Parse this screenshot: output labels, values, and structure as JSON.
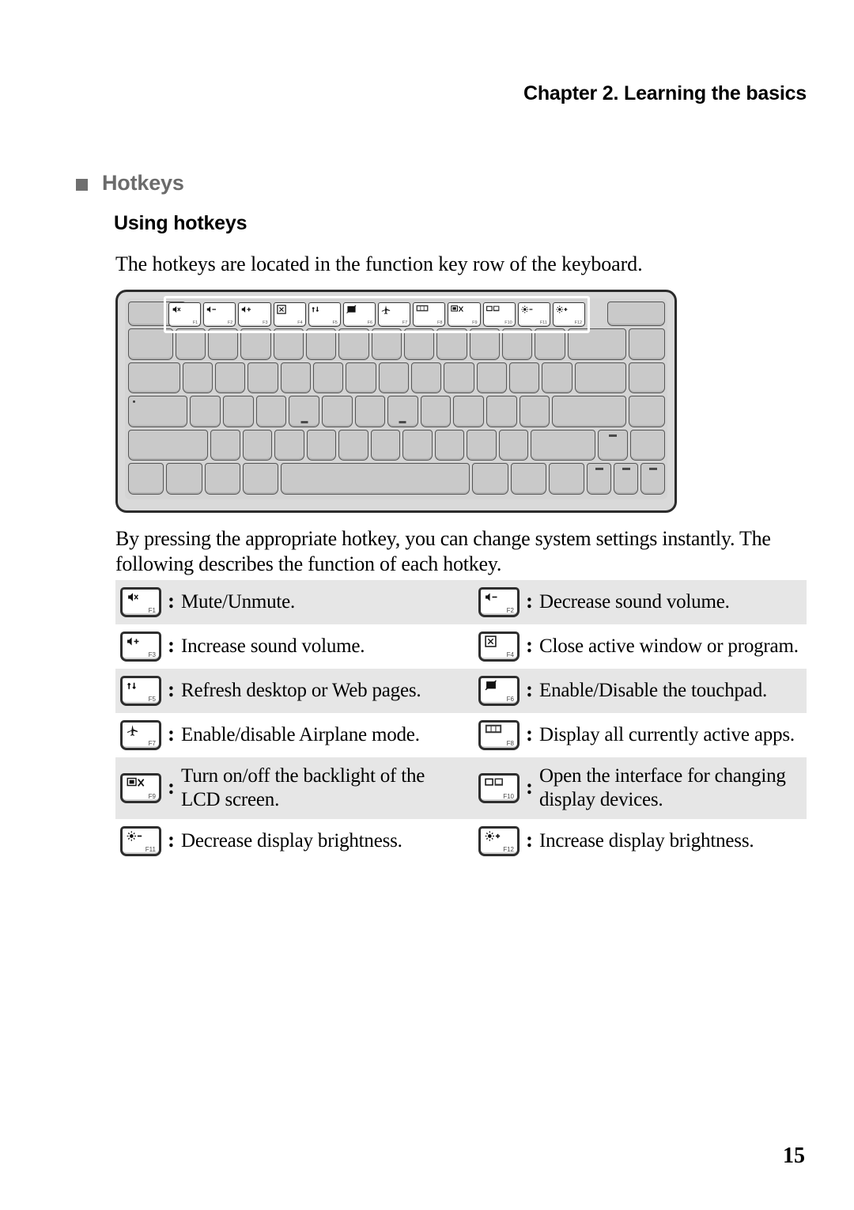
{
  "header": {
    "running_header": "Chapter 2. Learning the basics"
  },
  "section": {
    "bullet": "filled-square",
    "title": "Hotkeys",
    "subtitle": "Using hotkeys",
    "intro_paragraph": "The hotkeys are located in the function key row of the keyboard.",
    "body_paragraph": "By pressing the appropriate hotkey, you can change system settings instantly. The following describes the function of each hotkey."
  },
  "keyboard_figure": {
    "caption": "",
    "function_row_keys": [
      {
        "fkey": "F1",
        "icon": "mute-icon",
        "glyph": "×"
      },
      {
        "fkey": "F2",
        "icon": "volume-down-icon",
        "glyph": "−"
      },
      {
        "fkey": "F3",
        "icon": "volume-up-icon",
        "glyph": "+"
      },
      {
        "fkey": "F4",
        "icon": "close-window-icon",
        "glyph": "✕"
      },
      {
        "fkey": "F5",
        "icon": "refresh-icon",
        "glyph": "↺"
      },
      {
        "fkey": "F6",
        "icon": "touchpad-toggle-icon",
        "glyph": "╱"
      },
      {
        "fkey": "F7",
        "icon": "airplane-mode-icon",
        "glyph": "✈"
      },
      {
        "fkey": "F8",
        "icon": "task-view-icon",
        "glyph": "▭"
      },
      {
        "fkey": "F9",
        "icon": "lcd-backlight-icon",
        "glyph": "X"
      },
      {
        "fkey": "F10",
        "icon": "display-switch-icon",
        "glyph": "▭"
      },
      {
        "fkey": "F11",
        "icon": "brightness-down-icon",
        "glyph": "−"
      },
      {
        "fkey": "F12",
        "icon": "brightness-up-icon",
        "glyph": "+"
      }
    ]
  },
  "hotkey_table": {
    "rows": [
      {
        "shaded": true,
        "left": {
          "fkey": "F1",
          "icon": "mute-icon",
          "separator": ":",
          "description": "Mute/Unmute."
        },
        "right": {
          "fkey": "F2",
          "icon": "volume-down-icon",
          "separator": ":",
          "description": "Decrease sound volume."
        }
      },
      {
        "shaded": false,
        "left": {
          "fkey": "F3",
          "icon": "volume-up-icon",
          "separator": ":",
          "description": "Increase sound volume."
        },
        "right": {
          "fkey": "F4",
          "icon": "close-window-icon",
          "separator": ":",
          "description": "Close active window or program."
        }
      },
      {
        "shaded": true,
        "left": {
          "fkey": "F5",
          "icon": "refresh-icon",
          "separator": ":",
          "description": "Refresh desktop or Web pages."
        },
        "right": {
          "fkey": "F6",
          "icon": "touchpad-toggle-icon",
          "separator": ":",
          "description": "Enable/Disable the touchpad."
        }
      },
      {
        "shaded": false,
        "left": {
          "fkey": "F7",
          "icon": "airplane-mode-icon",
          "separator": ":",
          "description": "Enable/disable Airplane mode."
        },
        "right": {
          "fkey": "F8",
          "icon": "task-view-icon",
          "separator": ":",
          "description": "Display all currently active apps."
        }
      },
      {
        "shaded": true,
        "left": {
          "fkey": "F9",
          "icon": "lcd-backlight-icon",
          "separator": ":",
          "description": "Turn on/off the backlight of the LCD screen."
        },
        "right": {
          "fkey": "F10",
          "icon": "display-switch-icon",
          "separator": ":",
          "description": "Open the interface for changing display devices."
        }
      },
      {
        "shaded": false,
        "left": {
          "fkey": "F11",
          "icon": "brightness-down-icon",
          "separator": ":",
          "description": "Decrease display brightness."
        },
        "right": {
          "fkey": "F12",
          "icon": "brightness-up-icon",
          "separator": ":",
          "description": "Increase display brightness."
        }
      }
    ]
  },
  "footer": {
    "page_number": "15"
  },
  "colors": {
    "heading_gray": "#6b6b6b",
    "row_shade": "#e6e6e6",
    "keyboard_body": "#d9d9d9",
    "key_fill": "#c9c9c9",
    "ink": "#000000"
  }
}
